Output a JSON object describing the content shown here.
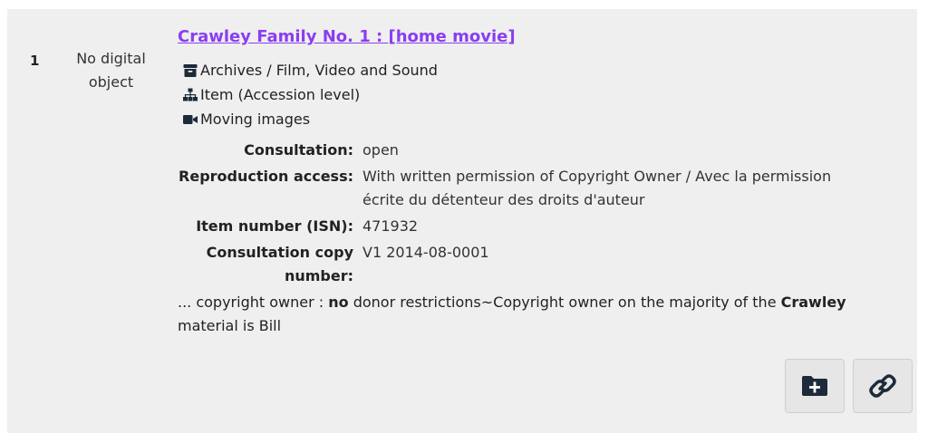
{
  "result": {
    "number": "1",
    "thumbnail_text": "No digital object",
    "title": "Crawley Family No. 1 : [home movie]",
    "meta": [
      {
        "icon": "archive-box-icon",
        "text": "Archives / Film, Video and Sound"
      },
      {
        "icon": "hierarchy-icon",
        "text": "Item (Accession level)"
      },
      {
        "icon": "video-camera-icon",
        "text": "Moving images"
      }
    ],
    "fields": [
      {
        "label": "Consultation:",
        "value": "open"
      },
      {
        "label": "Reproduction access:",
        "value": "With written permission of Copyright Owner / Avec la permission écrite du détenteur des droits d'auteur"
      },
      {
        "label": "Item number (ISN):",
        "value": "471932"
      },
      {
        "label": "Consultation copy number:",
        "value": "V1 2014-08-0001"
      }
    ],
    "snippet": {
      "p1": "... copyright owner : ",
      "b1": "no",
      "p2": " donor restrictions~Copyright owner on the majority of the ",
      "b2": "Crawley",
      "p3": " material is Bill"
    }
  },
  "actions": {
    "add_to_folder_icon": "folder-plus-icon",
    "link_icon": "link-icon"
  },
  "colors": {
    "title_link": "#8a3ef0",
    "icon": "#1c2a3a",
    "card_background": "#efefef",
    "button_background": "#e6e6e6"
  }
}
